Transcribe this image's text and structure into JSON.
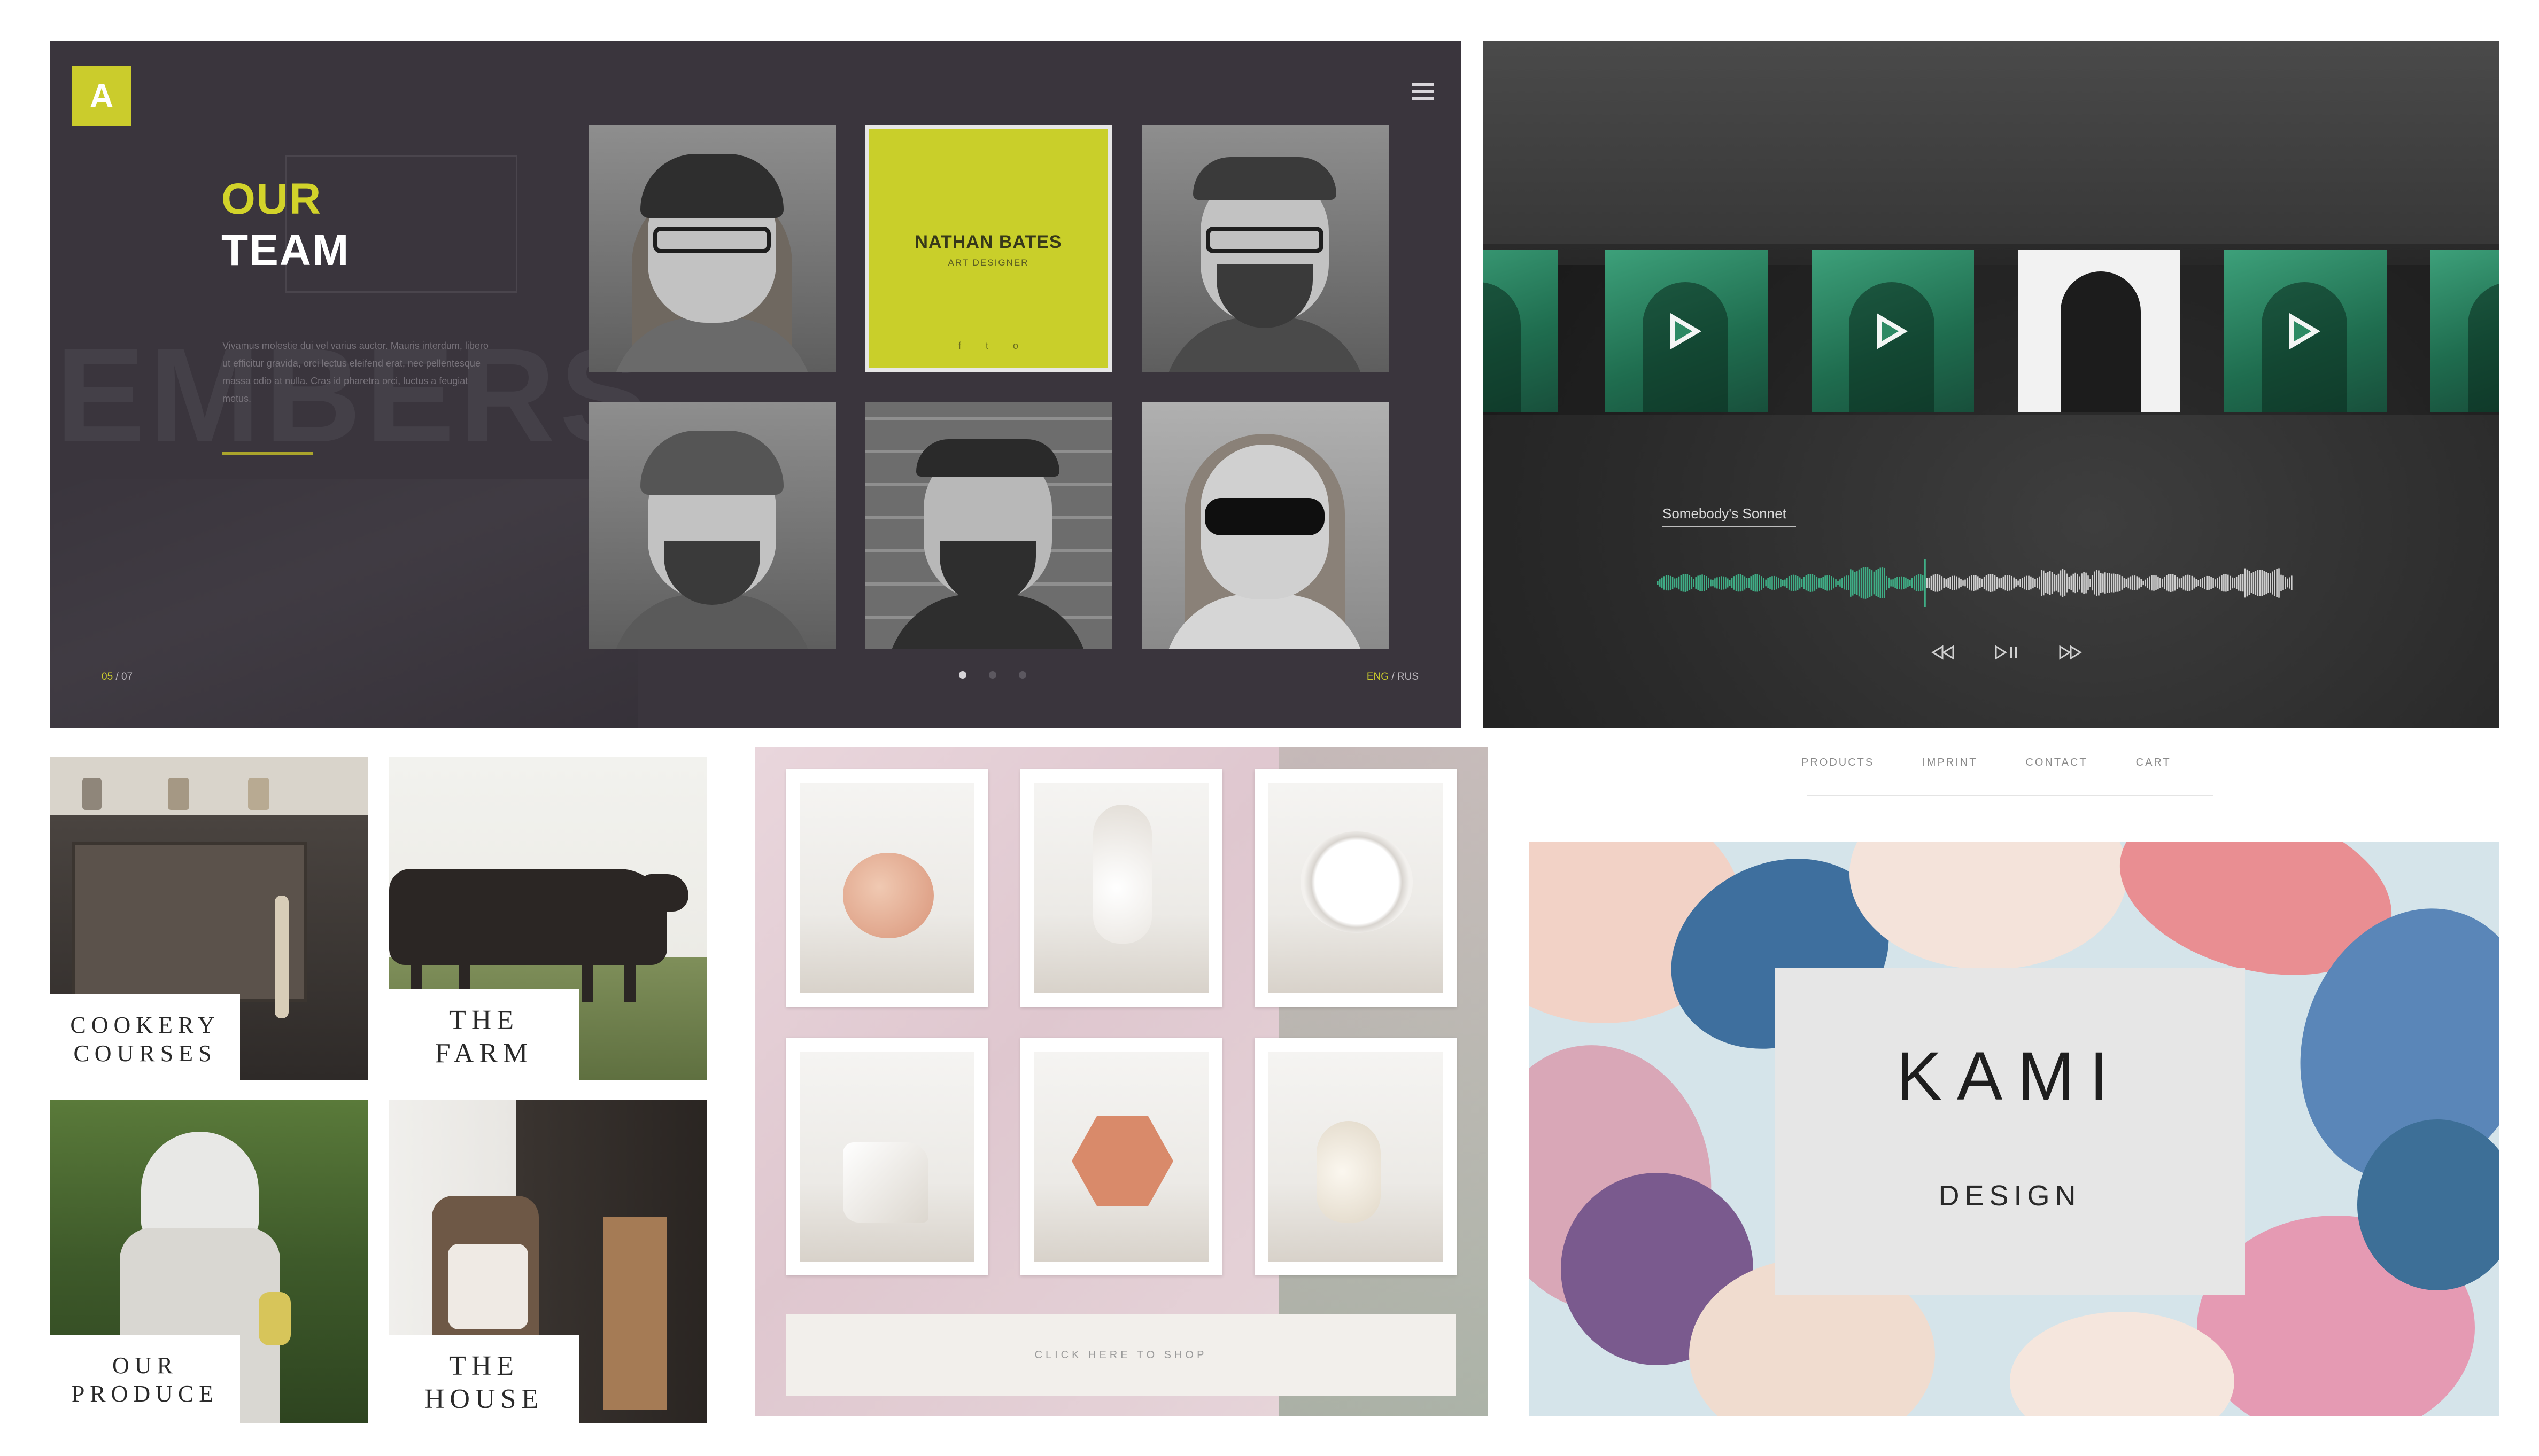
{
  "team_panel": {
    "logo_letter": "A",
    "title_line1": "OUR",
    "title_line2": "TEAM",
    "background_word": "EMBERS",
    "body_text": "Vivamus molestie dui vel varius auctor. Mauris interdum, libero ut efficitur gravida, orci lectus eleifend erat, nec pellentesque massa odio at nulla. Cras id pharetra orci, luctus a feugiat metus.",
    "page_current": "05",
    "page_total": "/ 07",
    "lang_current": "ENG",
    "lang_other": "/ RUS",
    "featured_member": {
      "name": "NATHAN BATES",
      "role": "ART DESIGNER",
      "social": [
        "f",
        "t",
        "o"
      ]
    },
    "accent_color": "#cbcc2c"
  },
  "music_panel": {
    "track_title": "Somebody's Sonnet",
    "controls": [
      "rewind-icon",
      "play-pause-icon",
      "fast-forward-icon"
    ],
    "accent_color": "#3da07a"
  },
  "farm_panel": {
    "tiles": [
      {
        "label": "COOKERY\nCOURSES"
      },
      {
        "label": "THE\nFARM"
      },
      {
        "label": "OUR\nPRODUCE"
      },
      {
        "label": "THE\nHOUSE"
      }
    ]
  },
  "ceramics_panel": {
    "shop_label": "CLICK HERE TO SHOP"
  },
  "kami_panel": {
    "nav": [
      "PRODUCTS",
      "IMPRINT",
      "CONTACT",
      "CART"
    ],
    "brand": "KAMI",
    "tagline": "DESIGN"
  }
}
